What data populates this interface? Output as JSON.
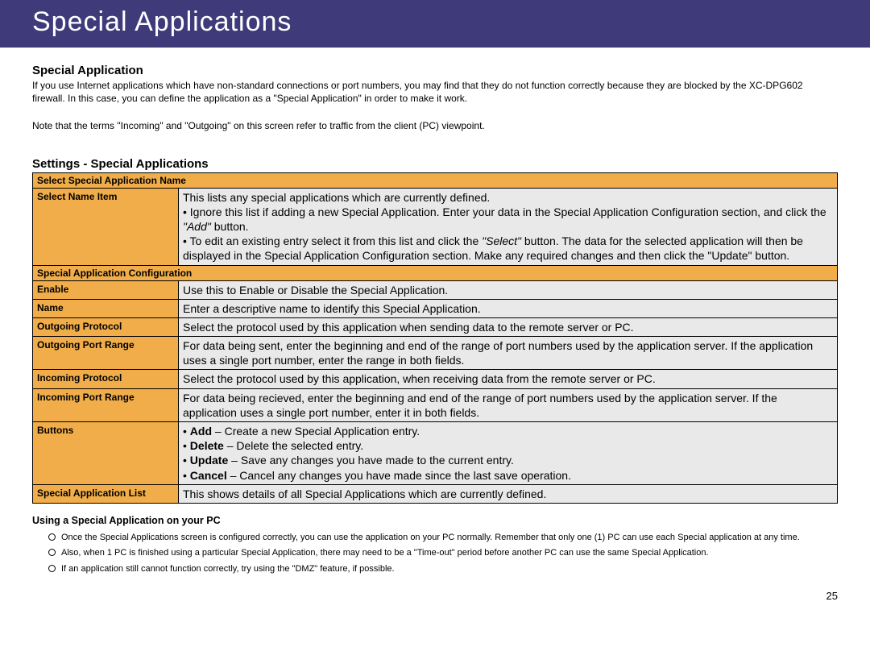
{
  "header": {
    "title": "Special Applications"
  },
  "section1": {
    "title": "Special Application",
    "intro": "If you use Internet applications which have non-standard connections or port numbers, you may find that they do not function correctly because they are blocked by the XC-DPG602 firewall. In this case, you can define the application as a \"Special Application\" in order to make it work.",
    "note": "Note that the terms \"Incoming\" and \"Outgoing\" on this screen refer to traffic from the client (PC) viewpoint."
  },
  "section2": {
    "title": "Settings - Special Applications",
    "group1_header": "Select Special Application Name",
    "group2_header": "Special Application Configuration",
    "rows": {
      "select_name": {
        "label": "Select Name Item",
        "line1": "This lists any special applications which are currently defined.",
        "bullet1_pre": "• Ignore this list if adding a new Special Application. Enter your data in the Special Application Configuration section, and click the ",
        "bullet1_em": "\"Add\"",
        "bullet1_post": " button.",
        "bullet2_pre": "• To edit an existing entry select it from this list and click the ",
        "bullet2_em": "\"Select\"",
        "bullet2_post": " button. The data for the selected application will then be displayed in the Special Application Configuration section. Make any required changes and then click the \"Update\" button."
      },
      "enable": {
        "label": "Enable",
        "text": "Use this to Enable or Disable the Special Application."
      },
      "name": {
        "label": "Name",
        "text": "Enter a descriptive name to identify this Special Application."
      },
      "out_proto": {
        "label": "Outgoing Protocol",
        "text": "Select the protocol used by this application when sending data to the remote server or PC."
      },
      "out_port": {
        "label": "Outgoing Port Range",
        "text": "For data being sent, enter the beginning and end of the range of port numbers used by the application server. If the application uses a single port number, enter the range in both fields."
      },
      "in_proto": {
        "label": "Incoming Protocol",
        "text": "Select the protocol used by this application, when receiving data from the remote server or PC."
      },
      "in_port": {
        "label": "Incoming Port Range",
        "text": "For data being recieved, enter the beginning and end of the range of port numbers used by the application server. If the application uses a single port number, enter it in both fields."
      },
      "buttons": {
        "label": "Buttons",
        "b1_lbl": "Add",
        "b1_txt": " – Create a new Special Application entry.",
        "b2_lbl": "Delete",
        "b2_txt": " – Delete the selected entry.",
        "b3_lbl": "Update",
        "b3_txt": " – Save any changes you have made to the current entry.",
        "b4_lbl": "Cancel",
        "b4_txt": " – Cancel any changes you have made since the last save operation."
      },
      "sal": {
        "label": "Special Application List",
        "text": "This shows details of all Special Applications which are currently defined."
      }
    }
  },
  "section3": {
    "title": "Using a Special Application on your PC",
    "items": [
      "Once the Special Applications screen is configured correctly, you can use the application on your PC normally. Remember that only one (1) PC can use each Special application at any time.",
      "Also, when 1 PC is finished using a particular Special Application, there may need to be a \"Time-out\" period before another PC can use the same Special Application.",
      "If an application still cannot function correctly, try using the \"DMZ\" feature, if possible."
    ]
  },
  "page_number": "25"
}
